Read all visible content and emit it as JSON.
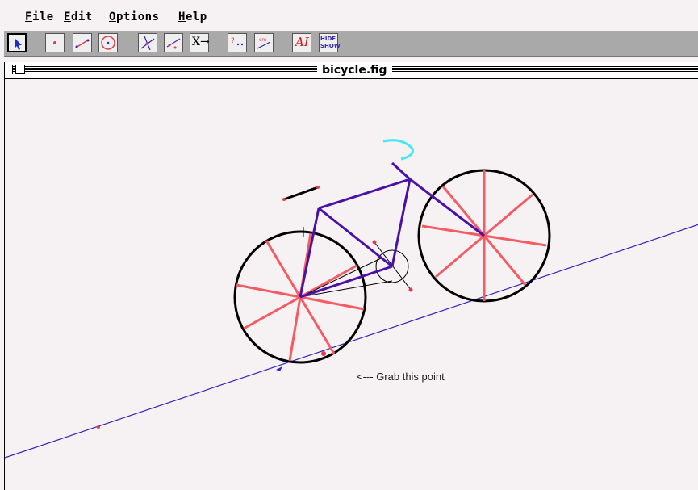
{
  "menu": {
    "items": [
      "File",
      "Edit",
      "Options",
      "Help"
    ]
  },
  "toolbar": {
    "tools": [
      "pointer-tool",
      "point-tool",
      "segment-tool",
      "circle-tool",
      "construct-line-tool",
      "construct-ray-tool",
      "transform-tool",
      "macro-tool",
      "measure-tool",
      "text-tool",
      "hide-show-tool"
    ],
    "transform_label": "X→",
    "text_label": "AI",
    "hide_label": "HIDE",
    "show_label": "SHOW"
  },
  "window": {
    "title": "bicycle.fig"
  },
  "canvas": {
    "annotation": "<--- Grab this point"
  },
  "colors": {
    "frame": "#4a11a8",
    "spokes": "#f45b62",
    "handlebar": "#48e8f2",
    "ground_line": "#3524b8",
    "points": "#e23b4a",
    "wheel": "#000000"
  }
}
